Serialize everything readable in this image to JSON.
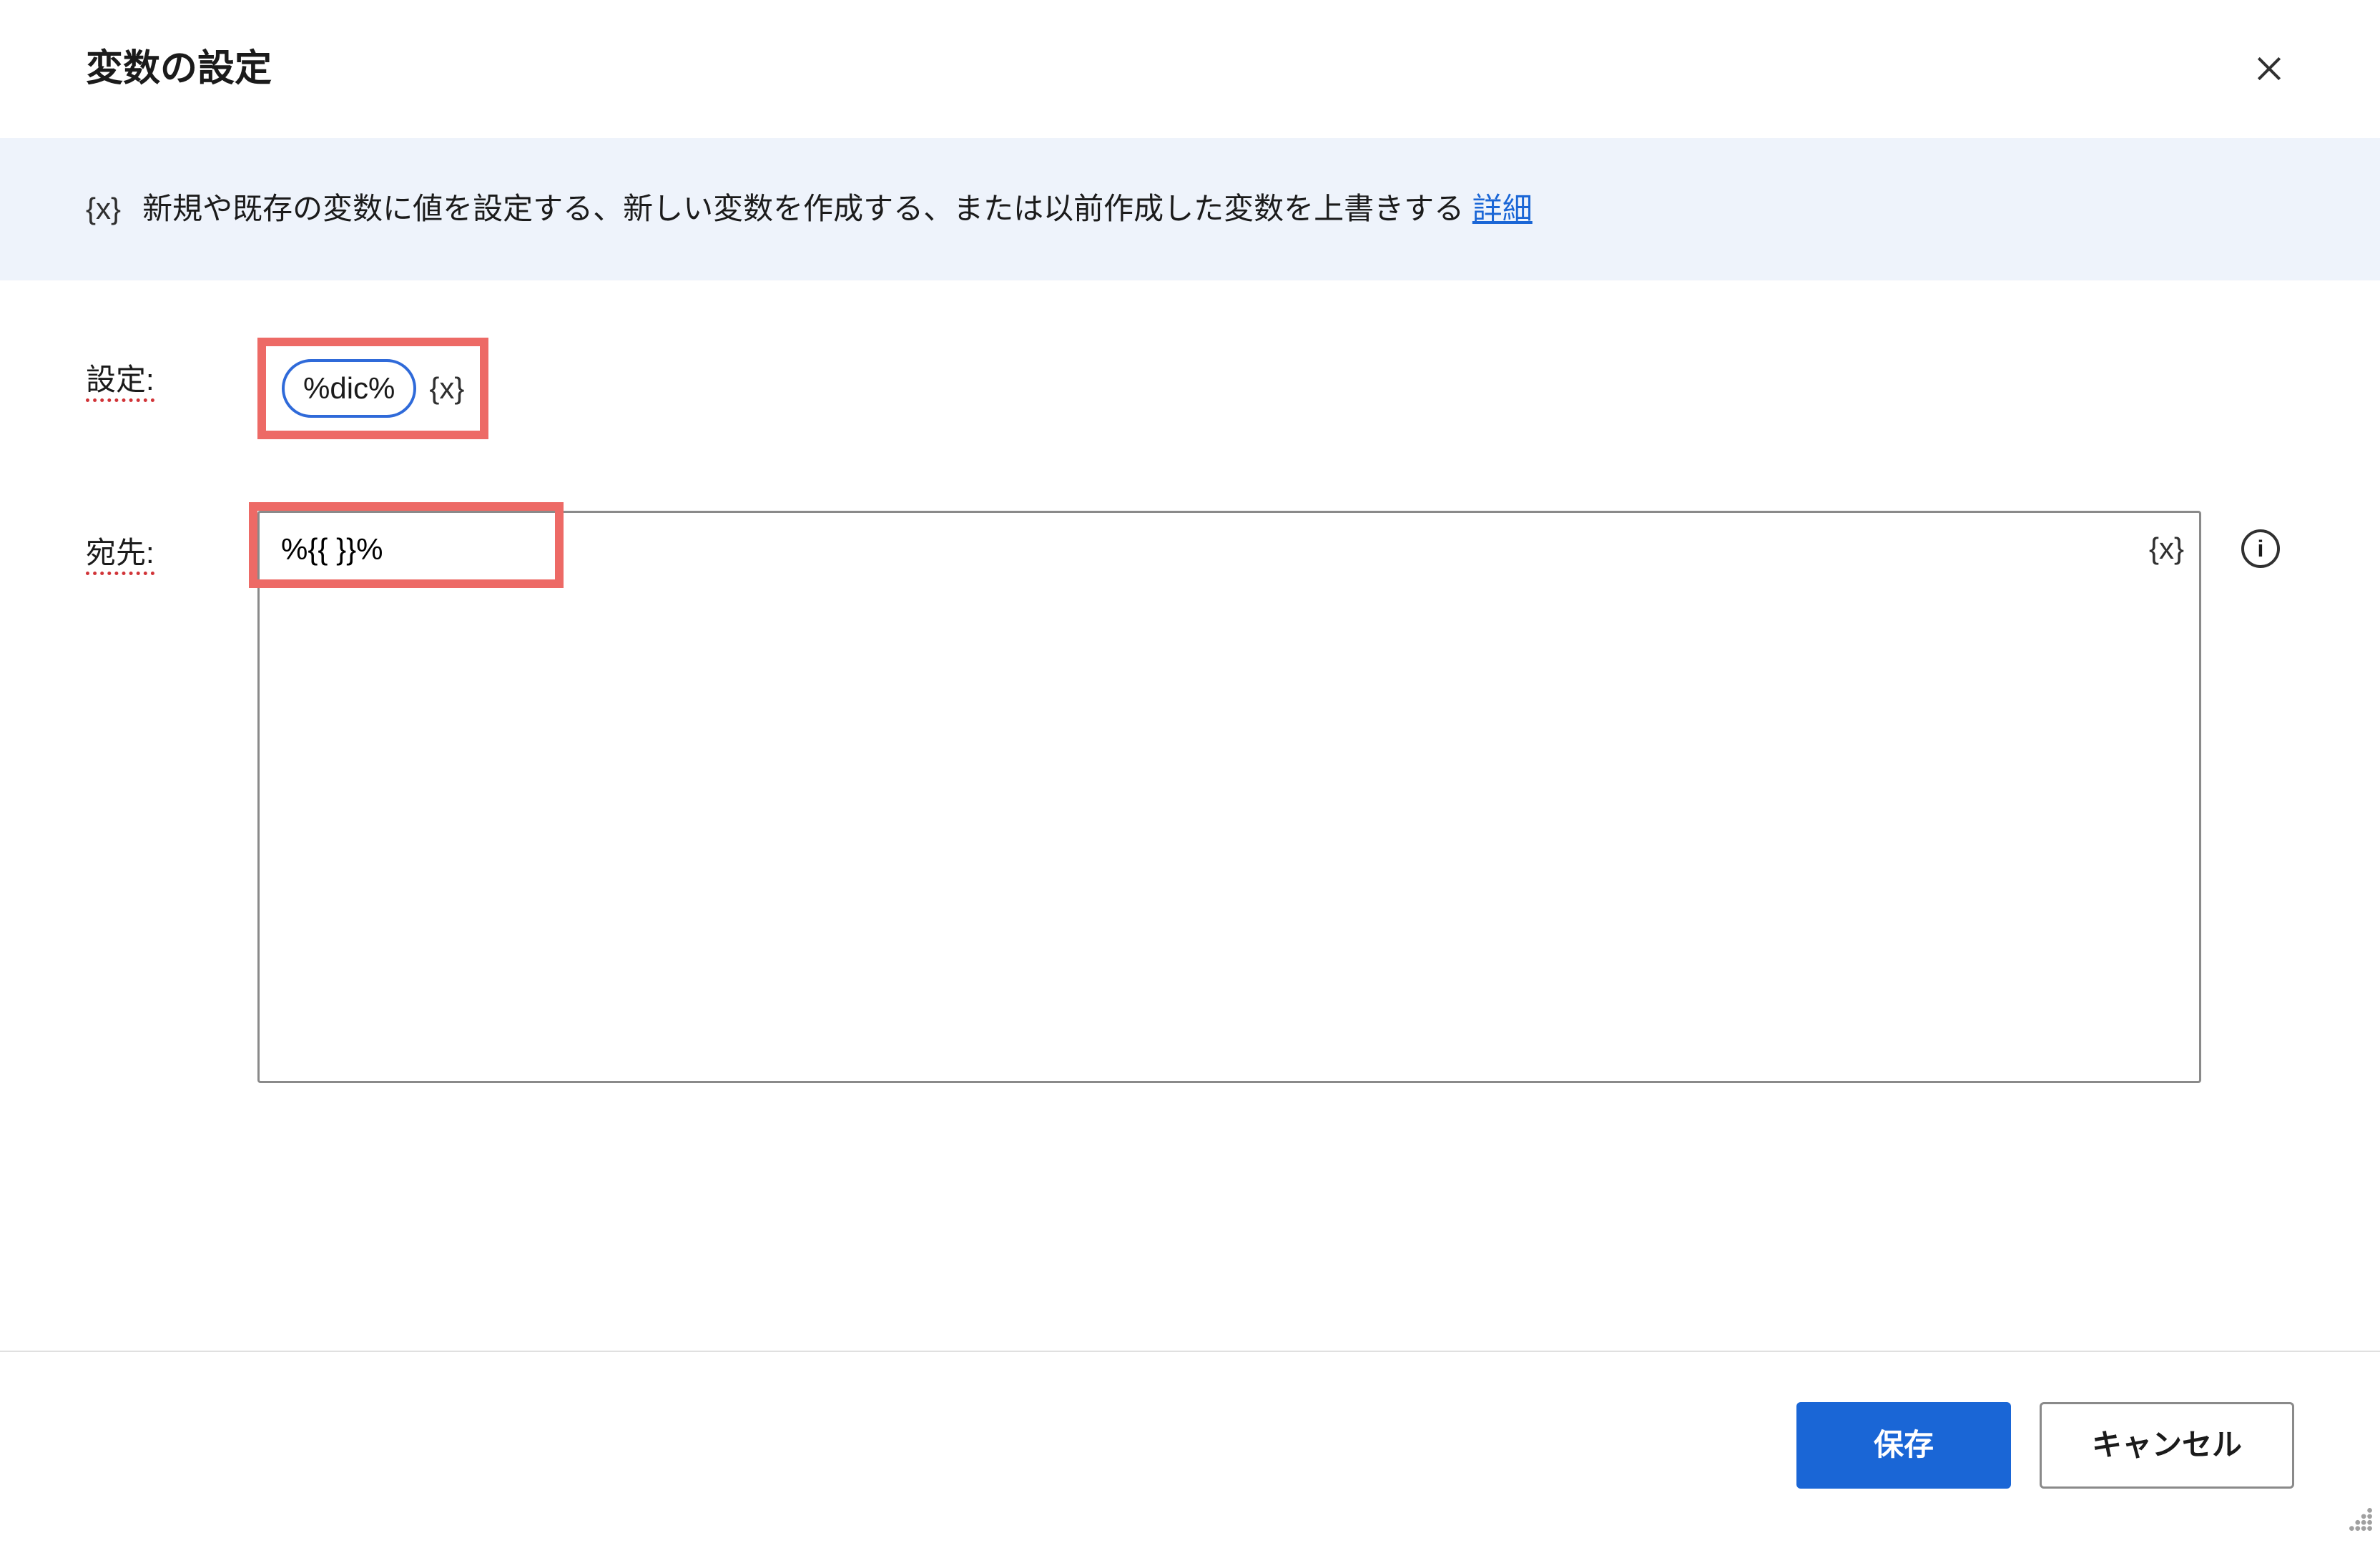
{
  "header": {
    "title": "変数の設定"
  },
  "banner": {
    "icon_label": "{x}",
    "description": "新規や既存の変数に値を設定する、新しい変数を作成する、または以前作成した変数を上書きする ",
    "details_link": "詳細"
  },
  "form": {
    "setting": {
      "label": "設定:",
      "chip": "%dic%",
      "braces_icon": "{x}"
    },
    "destination": {
      "label": "宛先:",
      "value": "%{{ }}%",
      "braces_icon": "{x}"
    }
  },
  "footer": {
    "save": "保存",
    "cancel": "キャンセル"
  }
}
